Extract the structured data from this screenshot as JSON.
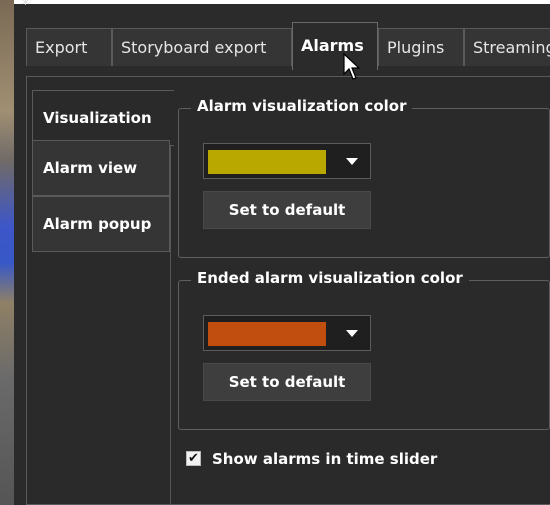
{
  "tabs": [
    {
      "label": "Export",
      "active": false
    },
    {
      "label": "Storyboard export",
      "active": false
    },
    {
      "label": "Alarms",
      "active": true
    },
    {
      "label": "Plugins",
      "active": false
    },
    {
      "label": "Streaming",
      "active": false
    }
  ],
  "sidebar": {
    "items": [
      {
        "label": "Visualization",
        "active": true
      },
      {
        "label": "Alarm view",
        "active": false
      },
      {
        "label": "Alarm popup",
        "active": false
      }
    ]
  },
  "alarm_group": {
    "title": "Alarm visualization color",
    "color": "#b9a800",
    "default_button": "Set to default"
  },
  "ended_group": {
    "title": "Ended alarm visualization color",
    "color": "#c14d0f",
    "default_button": "Set to default"
  },
  "show_in_slider": {
    "checked": true,
    "label": "Show alarms in time slider"
  },
  "icons": {
    "cursor": "mouse-pointer-icon",
    "dropdown": "chevron-down-icon",
    "check": "checkmark-icon"
  }
}
